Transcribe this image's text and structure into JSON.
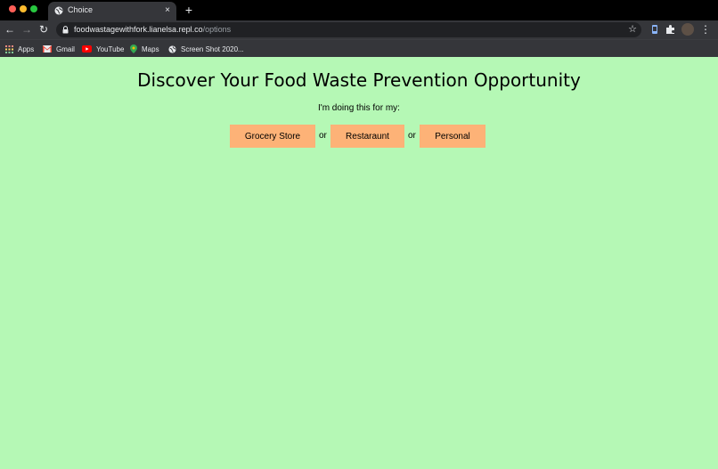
{
  "browser": {
    "tab": {
      "title": "Choice",
      "close": "×"
    },
    "new_tab": "+",
    "nav": {
      "back": "←",
      "forward": "→",
      "reload": "↻"
    },
    "address": {
      "host": "foodwastagewithfork.lianelsa.repl.co",
      "path": "/options"
    },
    "star": "☆",
    "menu": "⋮",
    "bookmarks": [
      {
        "label": "Apps",
        "icon": "apps-grid-icon"
      },
      {
        "label": "Gmail",
        "icon": "gmail-icon"
      },
      {
        "label": "YouTube",
        "icon": "youtube-icon"
      },
      {
        "label": "Maps",
        "icon": "maps-pin-icon"
      },
      {
        "label": "Screen Shot 2020...",
        "icon": "globe-icon"
      }
    ]
  },
  "page": {
    "headline": "Discover Your Food Waste Prevention Opportunity",
    "subtitle": "I'm doing this for my:",
    "choices": [
      {
        "label": "Grocery Store"
      },
      {
        "label": "Restaraunt"
      },
      {
        "label": "Personal"
      }
    ],
    "separator": "or"
  },
  "colors": {
    "page_background": "#b5f8b5",
    "button_background": "#fdb277",
    "chrome_dark": "#202124",
    "chrome_toolbar": "#35363a"
  }
}
